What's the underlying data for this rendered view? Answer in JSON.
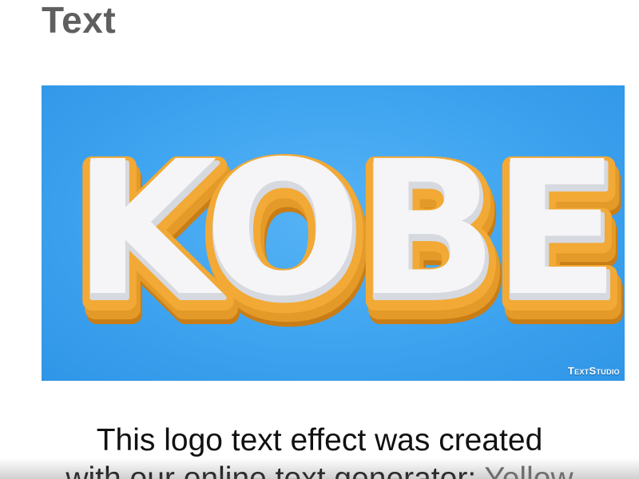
{
  "heading": "Text",
  "preview": {
    "logo_text": "KOBE",
    "watermark": "TextStudio",
    "colors": {
      "background": "#3ea4f0",
      "letter_face": "#f4f4f6",
      "letter_outline": "#f0a030",
      "extrusion": "#d98a1e"
    }
  },
  "description": {
    "line1": "This logo text effect was created",
    "line2_prefix": "with our online text generator:",
    "link_text": "Yellow"
  }
}
